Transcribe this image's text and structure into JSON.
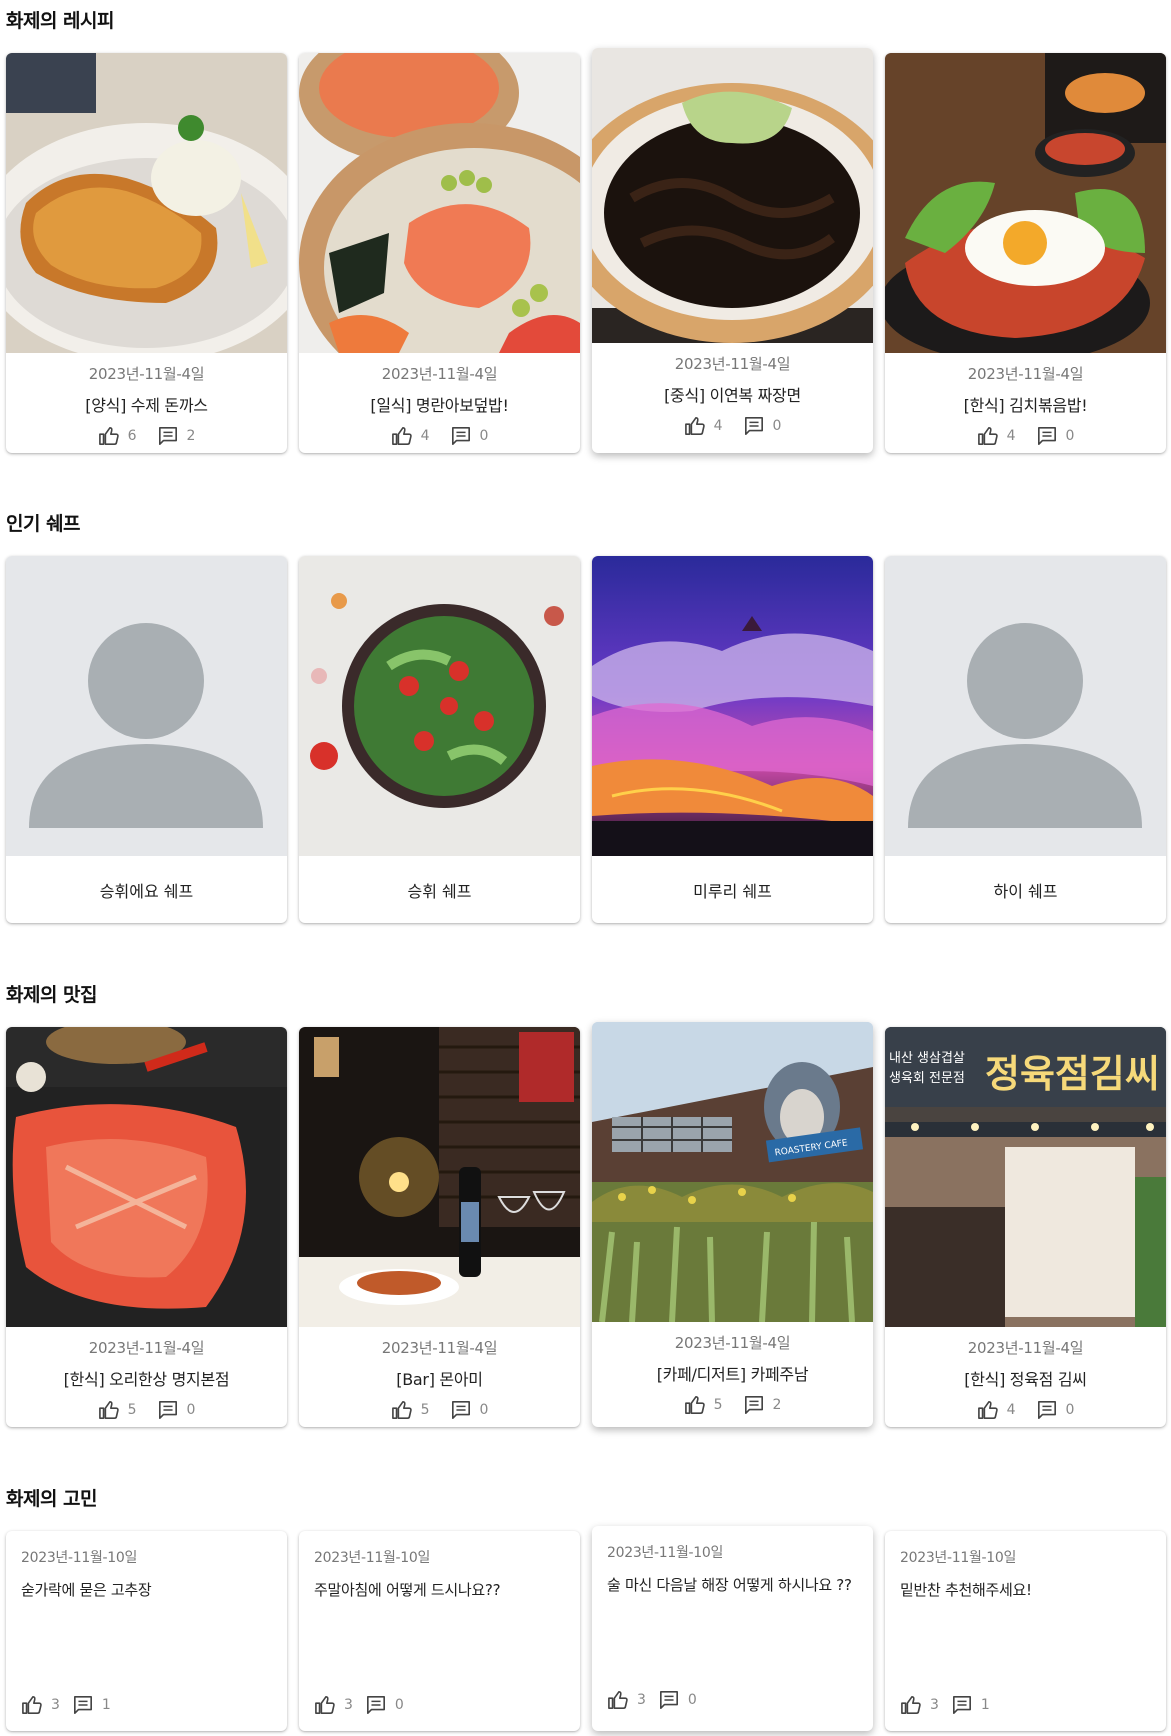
{
  "sections": {
    "recipes_title": "화제의 레시피",
    "chefs_title": "인기 쉐프",
    "restaurants_title": "화제의 맛집",
    "worries_title": "화제의 고민"
  },
  "recipes": [
    {
      "date": "2023년-11월-4일",
      "title": "[양식] 수제 돈까스",
      "likes": "6",
      "comments": "2",
      "image": "tonkatsu-photo"
    },
    {
      "date": "2023년-11월-4일",
      "title": "[일식] 명란아보덮밥!",
      "likes": "4",
      "comments": "0",
      "image": "poke-bowl-photo"
    },
    {
      "date": "2023년-11월-4일",
      "title": "[중식] 이연복 짜장면",
      "likes": "4",
      "comments": "0",
      "image": "jjajangmyeon-photo"
    },
    {
      "date": "2023년-11월-4일",
      "title": "[한식] 김치볶음밥!",
      "likes": "4",
      "comments": "0",
      "image": "kimchi-fried-rice-photo"
    }
  ],
  "chefs": [
    {
      "name": "승휘에요 쉐프",
      "image": "default-avatar"
    },
    {
      "name": "승휘 쉐프",
      "image": "salad-photo"
    },
    {
      "name": "미루리 쉐프",
      "image": "volcano-photo"
    },
    {
      "name": "하이 쉐프",
      "image": "default-avatar"
    }
  ],
  "restaurants": [
    {
      "date": "2023년-11월-4일",
      "title": "[한식] 오리한상 명지본점",
      "likes": "5",
      "comments": "0",
      "image": "duck-bbq-photo"
    },
    {
      "date": "2023년-11월-4일",
      "title": "[Bar] 몬아미",
      "likes": "5",
      "comments": "0",
      "image": "bar-interior-photo"
    },
    {
      "date": "2023년-11월-4일",
      "title": "[카페/디저트] 카페주남",
      "likes": "5",
      "comments": "2",
      "image": "cafe-building-photo"
    },
    {
      "date": "2023년-11월-4일",
      "title": "[한식] 정육점 김씨",
      "likes": "4",
      "comments": "0",
      "image": "butcher-storefront-photo"
    }
  ],
  "worries": [
    {
      "date": "2023년-11월-10일",
      "text": "숟가락에 묻은 고추장",
      "likes": "3",
      "comments": "1"
    },
    {
      "date": "2023년-11월-10일",
      "text": "주말아침에 어떻게 드시나요??",
      "likes": "3",
      "comments": "0"
    },
    {
      "date": "2023년-11월-10일",
      "text": "술 마신 다음날 해장 어떻게 하시나요 ??",
      "likes": "3",
      "comments": "0"
    },
    {
      "date": "2023년-11월-10일",
      "text": "밑반찬 추천해주세요!",
      "likes": "3",
      "comments": "1"
    }
  ],
  "photo_signs": {
    "cafe_sign": "ROASTERY CAFE",
    "butcher_sign": "정육점김씨",
    "butcher_sub1": "내산 생삼겹살",
    "butcher_sub2": "생육회 전문점"
  },
  "colors": {
    "avatar_bg": "#e5e7ea",
    "avatar_fg": "#a9afb3",
    "meta_text": "#777777"
  }
}
